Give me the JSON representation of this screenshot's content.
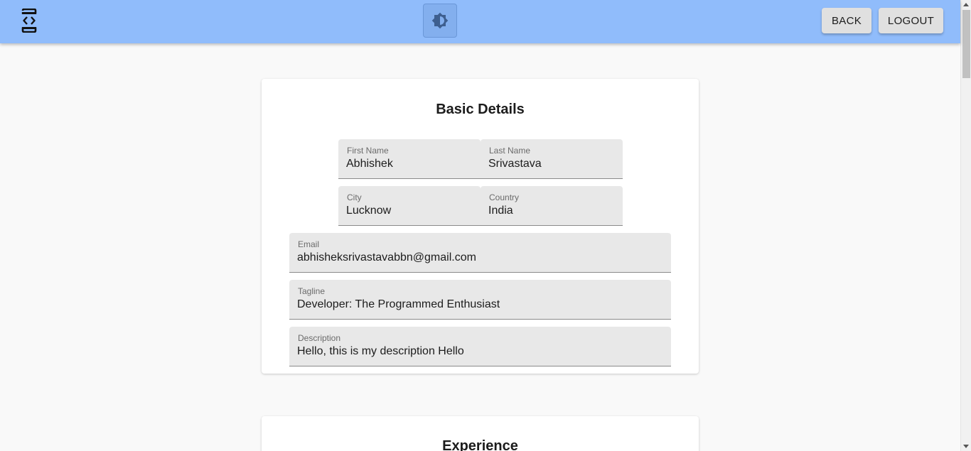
{
  "header": {
    "logo_icon": "code-brackets-logo-icon",
    "theme_icon": "brightness-icon",
    "back_label": "BACK",
    "logout_label": "LOGOUT"
  },
  "basic_details": {
    "title": "Basic Details",
    "first_name": {
      "label": "First Name",
      "value": "Abhishek"
    },
    "last_name": {
      "label": "Last Name",
      "value": "Srivastava"
    },
    "city": {
      "label": "City",
      "value": "Lucknow"
    },
    "country": {
      "label": "Country",
      "value": "India"
    },
    "email": {
      "label": "Email",
      "value": "abhisheksrivastavabbn@gmail.com"
    },
    "tagline": {
      "label": "Tagline",
      "value": "Developer: The Programmed Enthusiast"
    },
    "description": {
      "label": "Description",
      "value": "Hello, this is my description Hello"
    }
  },
  "experience": {
    "title": "Experience"
  },
  "colors": {
    "appbar": "#90bcfb",
    "background": "#f9f9f9",
    "field_fill": "#e8e8e8"
  }
}
